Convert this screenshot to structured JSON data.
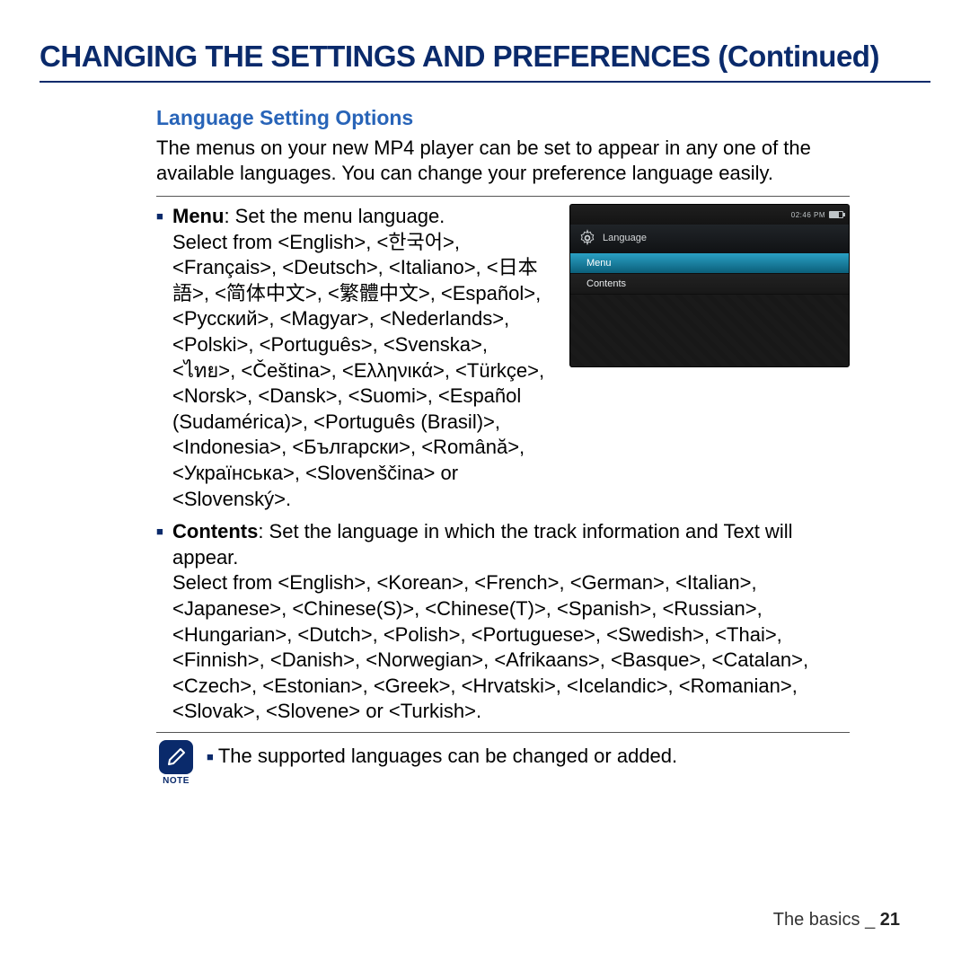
{
  "title": "CHANGING THE SETTINGS AND PREFERENCES (Continued)",
  "subtitle": "Language Setting Options",
  "intro": "The menus on your new MP4 player can be set to appear in any one of the available languages. You can change your preference language easily.",
  "bullets": {
    "menu_label": "Menu",
    "menu_lead": ": Set the menu language.",
    "menu_body": "Select from <English>, <한국어>, <Français>, <Deutsch>, <Italiano>, <日本語>, <简体中文>, <繁體中文>, <Español>, <Pусский>, <Magyar>, <Nederlands>, <Polski>, <Português>, <Svenska>, <ไทย>, <Čeština>, <Ελληνικά>, <Türkçe>, <Norsk>, <Dansk>, <Suomi>, <Español (Sudamérica)>, <Português (Brasil)>, <Indonesia>, <Български>, <Română>, <Українська>, <Slovenščina> or <Slovenský>.",
    "contents_label": "Contents",
    "contents_lead": ": Set the language in which the track information and Text will appear.",
    "contents_body": "Select from <English>, <Korean>, <French>, <German>, <Italian>, <Japanese>, <Chinese(S)>, <Chinese(T)>, <Spanish>, <Russian>, <Hungarian>, <Dutch>, <Polish>, <Portuguese>, <Swedish>, <Thai>, <Finnish>, <Danish>, <Norwegian>, <Afrikaans>, <Basque>, <Catalan>, <Czech>, <Estonian>, <Greek>, <Hrvatski>, <Icelandic>, <Romanian>, <Slovak>, <Slovene> or <Turkish>."
  },
  "device": {
    "time": "02:46 PM",
    "screen_title": "Language",
    "row_menu": "Menu",
    "row_contents": "Contents"
  },
  "note": {
    "label": "NOTE",
    "text": "The supported languages can be changed or added."
  },
  "footer": {
    "section": "The basics",
    "separator": "_",
    "page": "21"
  }
}
